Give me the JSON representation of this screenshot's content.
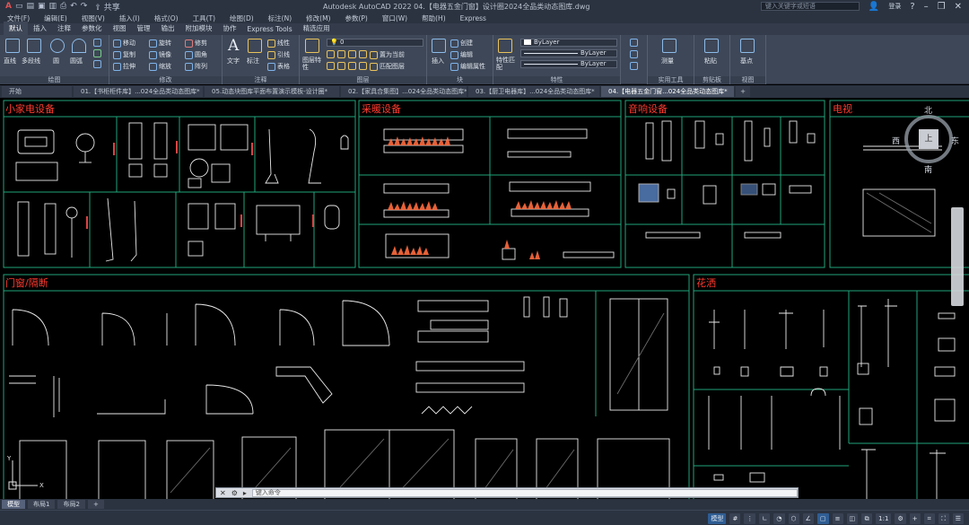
{
  "titlebar": {
    "share_label": "共享",
    "title": "Autodesk AutoCAD 2022    04.【电器五金门窗】设计圈2024全品类动态图库.dwg",
    "search_placeholder": "键入关键字或短语",
    "user_label": "登录"
  },
  "menu": [
    "文件(F)",
    "编辑(E)",
    "视图(V)",
    "插入(I)",
    "格式(O)",
    "工具(T)",
    "绘图(D)",
    "标注(N)",
    "修改(M)",
    "参数(P)",
    "窗口(W)",
    "帮助(H)",
    "Express"
  ],
  "ribbon_tabs": [
    "默认",
    "插入",
    "注释",
    "参数化",
    "视图",
    "管理",
    "输出",
    "附加模块",
    "协作",
    "Express Tools",
    "精选应用"
  ],
  "ribbon": {
    "draw": {
      "title": "绘图",
      "line": "直线",
      "polyline": "多段线",
      "circle": "圆",
      "arc": "圆弧"
    },
    "modify": {
      "title": "修改",
      "move": "移动",
      "rotate": "旋转",
      "trim": "修剪",
      "copy": "复制",
      "mirror": "镜像",
      "fillet": "圆角",
      "stretch": "拉伸",
      "scale": "缩放",
      "array": "阵列"
    },
    "annotation": {
      "title": "注释",
      "text": "文字",
      "dimension": "标注",
      "linear": "线性",
      "leader": "引线",
      "table": "表格"
    },
    "layers": {
      "title": "图层",
      "layer_props": "图层特性",
      "current_layer": "0",
      "make_current": "置为当前",
      "match_layer": "匹配图层"
    },
    "block": {
      "title": "块",
      "insert": "插入",
      "create": "创建",
      "edit": "编辑",
      "edit_attr": "编辑属性"
    },
    "properties": {
      "title": "特性",
      "match": "特性匹配",
      "color": "ByLayer",
      "linetype": "ByLayer",
      "lineweight": "ByLayer"
    },
    "utilities": {
      "title": "实用工具",
      "measure": "测量"
    },
    "clipboard": {
      "title": "剪贴板",
      "paste": "粘贴"
    },
    "view": {
      "title": "视图",
      "base": "基点"
    }
  },
  "doc_tabs": [
    {
      "label": "开始",
      "active": false
    },
    {
      "label": "01.【书柜柜件库】...024全品类动态图库*",
      "active": false
    },
    {
      "label": "05.动态块图库平面布置演示模板-设计圈*",
      "active": false
    },
    {
      "label": "02.【家具合集图】...024全品类动态图库*",
      "active": false
    },
    {
      "label": "03.【厨卫电器库】...024全品类动态图库*",
      "active": false
    },
    {
      "label": "04.【电器五金门窗...024全品类动态图库*",
      "active": true
    }
  ],
  "canvas": {
    "sections": {
      "appliances": "小家电设备",
      "heating": "采暖设备",
      "audio": "音响设备",
      "tv": "电视",
      "doors": "门窗/隔断",
      "shower": "花洒"
    },
    "viewcube": {
      "north": "北",
      "south": "南",
      "east": "东",
      "west": "西",
      "face": "上"
    },
    "ucs": {
      "x": "X",
      "y": "Y"
    },
    "accent_red": "#ff3b2f",
    "frame_green": "#1fa57a"
  },
  "command": {
    "placeholder": "键入命令"
  },
  "layout_tabs": [
    {
      "label": "模型",
      "active": true
    },
    {
      "label": "布局1",
      "active": false
    },
    {
      "label": "布局2",
      "active": false
    }
  ],
  "status": {
    "model_label": "模型",
    "scale": "1:1"
  }
}
